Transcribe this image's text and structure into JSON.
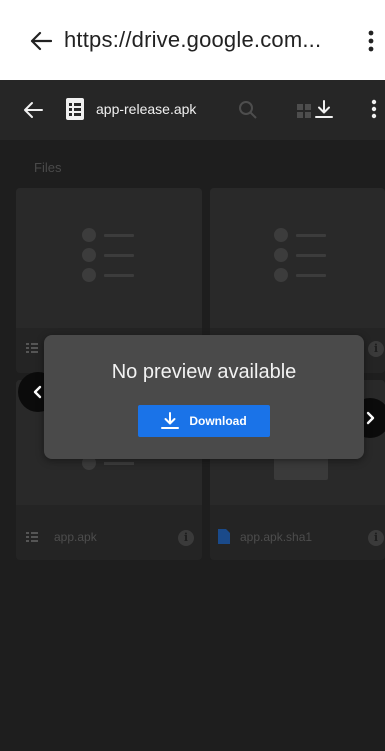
{
  "browser": {
    "url": "https://drive.google.com...",
    "back_icon": "arrow-left-icon",
    "menu_icon": "more-vert-icon"
  },
  "viewer": {
    "file_title": "app-release.apk",
    "files_label": "Files",
    "icons": [
      "arrow-left-icon",
      "file-list-icon",
      "search-icon",
      "grid-icon",
      "download-icon",
      "more-vert-icon"
    ]
  },
  "dialog": {
    "message": "No preview available",
    "download_label": "Download"
  },
  "cards": [
    {
      "name": "app.apk",
      "type": "list"
    },
    {
      "name": "app.apk.sha1",
      "type": "doc"
    }
  ],
  "colors": {
    "accent": "#1a73e8",
    "dialog_bg": "#4a4a4a",
    "viewer_bg": "#1e1e1e"
  }
}
